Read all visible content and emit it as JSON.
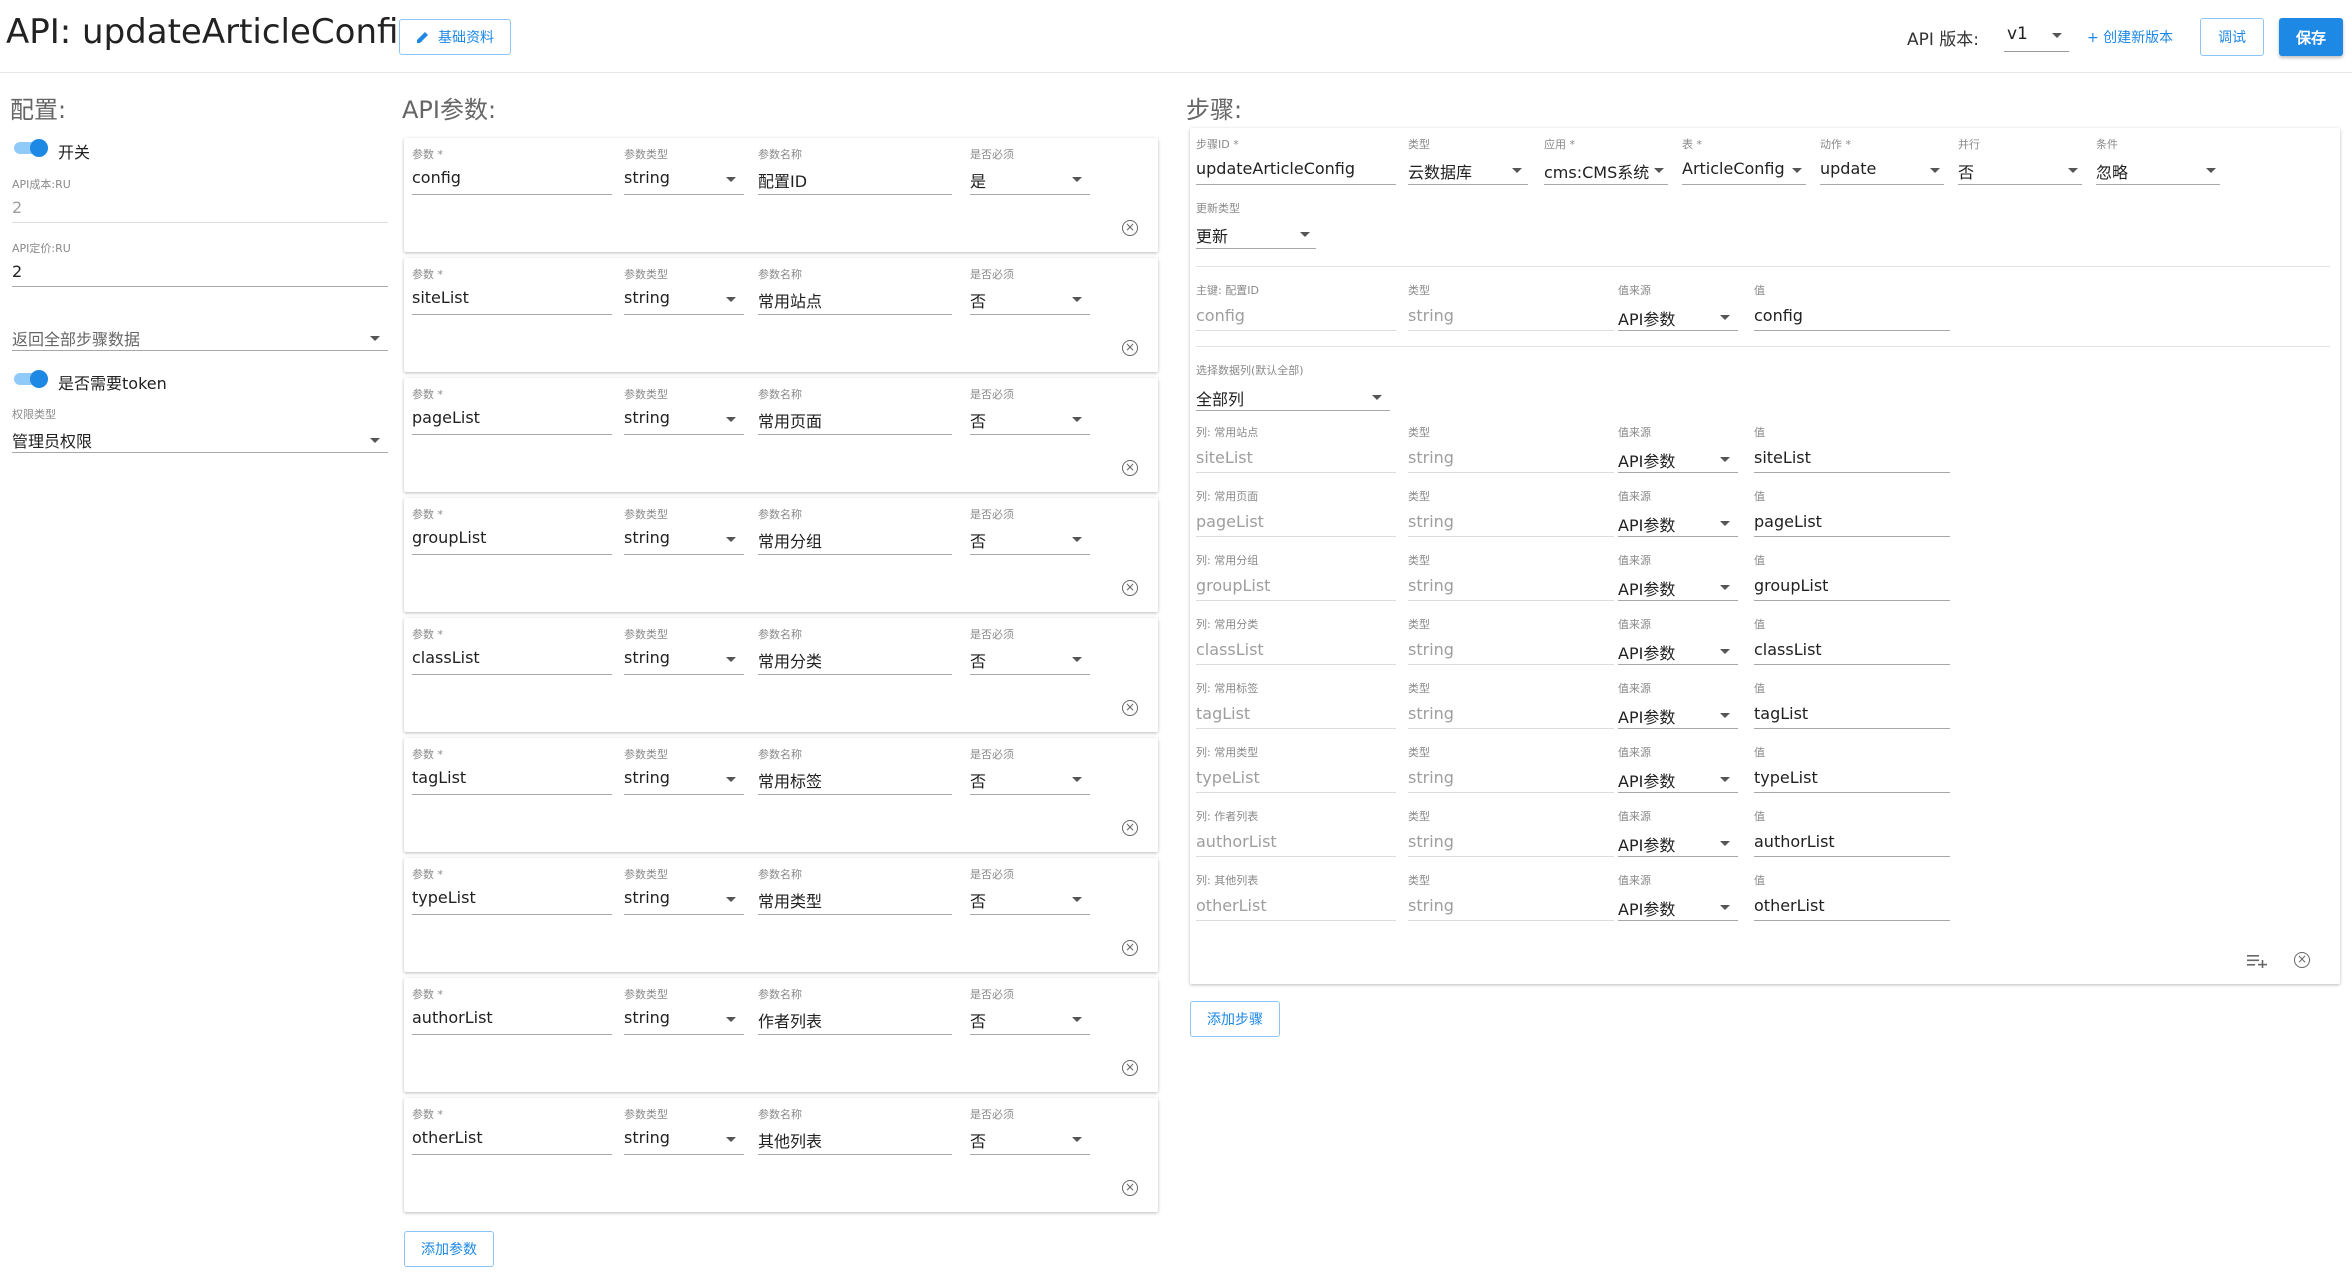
{
  "header": {
    "title": "API: updateArticleConfig",
    "basic_info_button": "基础资料",
    "api_version_label": "API 版本:",
    "api_version_value": "v1",
    "create_version_link": "+ 创建新版本",
    "debug_button": "调试",
    "save_button": "保存"
  },
  "config": {
    "section_title": "配置:",
    "switch_label": "开关",
    "cost_label": "API成本:RU",
    "cost_value": "2",
    "price_label": "API定价:RU",
    "price_value": "2",
    "return_all_select": "返回全部步骤数据",
    "token_label": "是否需要token",
    "permission_label": "权限类型",
    "permission_value": "管理员权限"
  },
  "params": {
    "section_title": "API参数:",
    "labels": {
      "name": "参数 *",
      "type": "参数类型",
      "desc": "参数名称",
      "required": "是否必须"
    },
    "items": [
      {
        "name": "config",
        "type": "string",
        "desc": "配置ID",
        "required": "是"
      },
      {
        "name": "siteList",
        "type": "string",
        "desc": "常用站点",
        "required": "否"
      },
      {
        "name": "pageList",
        "type": "string",
        "desc": "常用页面",
        "required": "否"
      },
      {
        "name": "groupList",
        "type": "string",
        "desc": "常用分组",
        "required": "否"
      },
      {
        "name": "classList",
        "type": "string",
        "desc": "常用分类",
        "required": "否"
      },
      {
        "name": "tagList",
        "type": "string",
        "desc": "常用标签",
        "required": "否"
      },
      {
        "name": "typeList",
        "type": "string",
        "desc": "常用类型",
        "required": "否"
      },
      {
        "name": "authorList",
        "type": "string",
        "desc": "作者列表",
        "required": "否"
      },
      {
        "name": "otherList",
        "type": "string",
        "desc": "其他列表",
        "required": "否"
      }
    ],
    "add_button": "添加参数"
  },
  "steps": {
    "section_title": "步骤:",
    "step": {
      "labels": {
        "id": "步骤ID *",
        "type": "类型",
        "app": "应用 *",
        "table": "表 *",
        "action": "动作 *",
        "parallel": "并行",
        "condition": "条件",
        "update_type": "更新类型"
      },
      "id": "updateArticleConfig",
      "type": "云数据库",
      "app": "cms:CMS系统",
      "table": "ArticleConfig",
      "action": "update",
      "parallel": "否",
      "condition": "忽略",
      "update_type": "更新"
    },
    "key_row": {
      "labels": {
        "col": "主键: 配置ID",
        "type": "类型",
        "source": "值来源",
        "value": "值"
      },
      "col": "config",
      "type": "string",
      "source": "API参数",
      "value": "config"
    },
    "select_columns": {
      "label": "选择数据列(默认全部)",
      "value": "全部列"
    },
    "column_rows": [
      {
        "label": "列: 常用站点",
        "col": "siteList",
        "type": "string",
        "source": "API参数",
        "value": "siteList"
      },
      {
        "label": "列: 常用页面",
        "col": "pageList",
        "type": "string",
        "source": "API参数",
        "value": "pageList"
      },
      {
        "label": "列: 常用分组",
        "col": "groupList",
        "type": "string",
        "source": "API参数",
        "value": "groupList"
      },
      {
        "label": "列: 常用分类",
        "col": "classList",
        "type": "string",
        "source": "API参数",
        "value": "classList"
      },
      {
        "label": "列: 常用标签",
        "col": "tagList",
        "type": "string",
        "source": "API参数",
        "value": "tagList"
      },
      {
        "label": "列: 常用类型",
        "col": "typeList",
        "type": "string",
        "source": "API参数",
        "value": "typeList"
      },
      {
        "label": "列: 作者列表",
        "col": "authorList",
        "type": "string",
        "source": "API参数",
        "value": "authorList"
      },
      {
        "label": "列: 其他列表",
        "col": "otherList",
        "type": "string",
        "source": "API参数",
        "value": "otherList"
      }
    ],
    "row_labels": {
      "type": "类型",
      "source": "值来源",
      "value": "值"
    },
    "add_button": "添加步骤"
  },
  "colors": {
    "accent": "#1e88e5",
    "accent_light": "#90caf9"
  }
}
